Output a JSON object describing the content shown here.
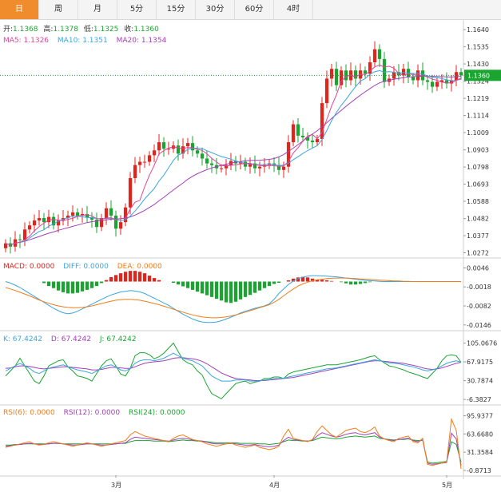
{
  "tabs": [
    "日",
    "周",
    "月",
    "5分",
    "15分",
    "30分",
    "60分",
    "4时"
  ],
  "active_tab": 0,
  "colors": {
    "up": "#e4231b",
    "down": "#1aa531",
    "ma5": "#e0449a",
    "ma10": "#3aa6e0",
    "ma20": "#a340b6",
    "dif": "#3aa6e0",
    "dea": "#f07d1a",
    "k": "#3aa6e0",
    "d": "#a340b6",
    "j": "#1aa531",
    "rsi6": "#f07d1a",
    "rsi12": "#a340b6",
    "rsi24": "#1aa531"
  },
  "legend": {
    "ohlc": {
      "open_label": "开:",
      "open": "1.1368",
      "high_label": "高:",
      "high": "1.1378",
      "low_label": "低:",
      "low": "1.1325",
      "close_label": "收:",
      "close": "1.1360"
    },
    "ma": {
      "ma5": "MA5: 1.1326",
      "ma10": "MA10: 1.1351",
      "ma20": "MA20: 1.1354"
    },
    "macd": {
      "macd": "MACD: 0.0000",
      "dif": "DIFF: 0.0000",
      "dea": "DEA: 0.0000"
    },
    "kdj": {
      "k": "K: 67.4242",
      "d": "D: 67.4242",
      "j": "J: 67.4242"
    },
    "rsi": {
      "r6": "RSI(6): 0.0000",
      "r12": "RSI(12): 0.0000",
      "r24": "RSI(24): 0.0000"
    }
  },
  "chart_data": {
    "type": "candlestick",
    "last_price": "1.1360",
    "price_axis": [
      "1.1640",
      "1.1535",
      "1.1430",
      "1.1324",
      "1.1219",
      "1.1114",
      "1.1009",
      "1.0903",
      "1.0798",
      "1.0693",
      "1.0588",
      "1.0482",
      "1.0377",
      "1.0272"
    ],
    "price_range": [
      1.025,
      1.168
    ],
    "macd_axis": [
      "0.0046",
      "-0.0018",
      "-0.0082",
      "-0.0146"
    ],
    "macd_range": [
      -0.016,
      0.0066
    ],
    "kdj_axis": [
      "105.0676",
      "67.9175",
      "30.7874",
      "-6.3827"
    ],
    "kdj_range": [
      -14,
      120
    ],
    "rsi_axis": [
      "95.9377",
      "63.6680",
      "31.3584",
      "-0.8713"
    ],
    "rsi_range": [
      -8,
      108
    ],
    "x_labels": [
      {
        "label": "3月",
        "index": 23
      },
      {
        "label": "4月",
        "index": 56
      },
      {
        "label": "5月",
        "index": 92
      }
    ],
    "closes": [
      1.033,
      1.031,
      1.0355,
      1.035,
      1.0415,
      1.044,
      1.047,
      1.0485,
      1.046,
      1.0492,
      1.044,
      1.047,
      1.0485,
      1.05,
      1.052,
      1.05,
      1.051,
      1.049,
      1.0475,
      1.043,
      1.0485,
      1.0545,
      1.05,
      1.042,
      1.046,
      1.055,
      1.073,
      1.081,
      1.083,
      1.083,
      1.087,
      1.09,
      1.095,
      1.091,
      1.091,
      1.093,
      1.088,
      1.0925,
      1.0945,
      1.09,
      1.088,
      1.085,
      1.082,
      1.081,
      1.079,
      1.079,
      1.081,
      1.0835,
      1.082,
      1.083,
      1.08,
      1.082,
      1.079,
      1.08,
      1.081,
      1.082,
      1.081,
      1.078,
      1.08,
      1.095,
      1.106,
      1.099,
      1.098,
      1.096,
      1.095,
      1.097,
      1.119,
      1.134,
      1.14,
      1.13,
      1.139,
      1.133,
      1.139,
      1.134,
      1.139,
      1.137,
      1.144,
      1.152,
      1.146,
      1.132,
      1.134,
      1.138,
      1.136,
      1.14,
      1.135,
      1.133,
      1.139,
      1.133,
      1.132,
      1.129,
      1.132,
      1.133,
      1.131,
      1.133,
      1.138,
      1.136
    ],
    "ma5": [
      1.033,
      1.032,
      1.0332,
      1.0336,
      1.0352,
      1.0374,
      1.0406,
      1.0433,
      1.0454,
      1.0473,
      1.0477,
      1.0473,
      1.0469,
      1.0477,
      1.0483,
      1.0495,
      1.0503,
      1.0504,
      1.0499,
      1.0481,
      1.0478,
      1.0485,
      1.0487,
      1.0476,
      1.0482,
      1.0483,
      1.0541,
      1.0582,
      1.0594,
      1.0676,
      1.0748,
      1.0808,
      1.0878,
      1.0898,
      1.0914,
      1.0922,
      1.0916,
      1.0911,
      1.0918,
      1.0916,
      1.0906,
      1.09,
      1.0879,
      1.0852,
      1.083,
      1.0808,
      1.0804,
      1.0809,
      1.0811,
      1.0817,
      1.0819,
      1.0821,
      1.0812,
      1.0808,
      1.0804,
      1.0808,
      1.0806,
      1.0802,
      1.0804,
      1.0832,
      1.0884,
      1.0916,
      1.0956,
      1.0988,
      1.0998,
      1.097,
      1.101,
      1.109,
      1.1172,
      1.124,
      1.1324,
      1.1352,
      1.1362,
      1.135,
      1.1368,
      1.1364,
      1.1386,
      1.1412,
      1.1424,
      1.141,
      1.1416,
      1.1404,
      1.1372,
      1.136,
      1.137,
      1.1364,
      1.1362,
      1.1358,
      1.135,
      1.1336,
      1.133,
      1.1318,
      1.1314,
      1.1314,
      1.133,
      1.1342
    ],
    "ma10": [
      1.033,
      1.032,
      1.0332,
      1.0336,
      1.0342,
      1.0363,
      1.0383,
      1.0403,
      1.0413,
      1.0435,
      1.0449,
      1.0465,
      1.0478,
      1.0487,
      1.0497,
      1.0497,
      1.0493,
      1.0488,
      1.0487,
      1.0482,
      1.048,
      1.0484,
      1.0483,
      1.0475,
      1.0469,
      1.0474,
      1.0497,
      1.0528,
      1.0563,
      1.0602,
      1.0634,
      1.0667,
      1.0712,
      1.0748,
      1.0793,
      1.0839,
      1.0871,
      1.0883,
      1.0906,
      1.0913,
      1.0913,
      1.0911,
      1.0898,
      1.0886,
      1.0874,
      1.0862,
      1.0855,
      1.0846,
      1.0835,
      1.0828,
      1.082,
      1.0817,
      1.0813,
      1.0812,
      1.0813,
      1.0815,
      1.0813,
      1.0807,
      1.081,
      1.082,
      1.0843,
      1.0861,
      1.0881,
      1.0899,
      1.0914,
      1.0929,
      1.0966,
      1.1022,
      1.1082,
      1.1132,
      1.1176,
      1.1212,
      1.1253,
      1.1291,
      1.1325,
      1.134,
      1.1367,
      1.1382,
      1.1389,
      1.138,
      1.1383,
      1.1379,
      1.1372,
      1.1378,
      1.1374,
      1.137,
      1.1374,
      1.1367,
      1.1357,
      1.1348,
      1.1346,
      1.134,
      1.1333,
      1.1327,
      1.133,
      1.1336
    ],
    "ma20": [
      1.033,
      1.032,
      1.0332,
      1.0336,
      1.0342,
      1.0352,
      1.0362,
      1.0372,
      1.0382,
      1.0392,
      1.04,
      1.041,
      1.0418,
      1.0426,
      1.0434,
      1.0442,
      1.045,
      1.0457,
      1.0463,
      1.0467,
      1.047,
      1.0474,
      1.0478,
      1.0478,
      1.0481,
      1.0485,
      1.0492,
      1.0503,
      1.0517,
      1.0532,
      1.055,
      1.0568,
      1.0591,
      1.0612,
      1.0635,
      1.0657,
      1.0679,
      1.07,
      1.0723,
      1.0741,
      1.0757,
      1.077,
      1.0782,
      1.0792,
      1.0801,
      1.0808,
      1.0815,
      1.0822,
      1.0828,
      1.0832,
      1.0836,
      1.0838,
      1.0839,
      1.084,
      1.0842,
      1.0845,
      1.085,
      1.086,
      1.0875,
      1.0893,
      1.0914,
      1.0935,
      1.0957,
      1.0979,
      1.1,
      1.1021,
      1.1045,
      1.107,
      1.1096,
      1.112,
      1.1145,
      1.1169,
      1.1193,
      1.1216,
      1.1239,
      1.1259,
      1.1279,
      1.1298,
      1.1314,
      1.1323,
      1.133,
      1.1336,
      1.1341,
      1.1346,
      1.135,
      1.1352,
      1.1354,
      1.1355,
      1.1355,
      1.1354,
      1.1353,
      1.1352,
      1.1351,
      1.135,
      1.1352,
      1.1354
    ],
    "macd_hist": [
      0,
      0,
      0,
      0,
      0,
      0,
      0,
      0,
      -0.0005,
      -0.0015,
      -0.0022,
      -0.003,
      -0.0036,
      -0.004,
      -0.004,
      -0.0038,
      -0.0033,
      -0.0028,
      -0.0022,
      -0.0015,
      -0.0005,
      0.0005,
      0.0015,
      0.0022,
      0.0028,
      0.0033,
      0.0036,
      0.0036,
      0.0033,
      0.0028,
      0.002,
      0.0012,
      0.0005,
      0,
      0,
      -0.0004,
      -0.001,
      -0.0016,
      -0.0022,
      -0.0028,
      -0.0034,
      -0.004,
      -0.0046,
      -0.0052,
      -0.0058,
      -0.0064,
      -0.007,
      -0.0072,
      -0.0068,
      -0.006,
      -0.0052,
      -0.0045,
      -0.0038,
      -0.003,
      -0.0022,
      -0.0015,
      -0.0008,
      -0.0004,
      0,
      0.0004,
      0.001,
      0.0014,
      0.0016,
      0.0014,
      0.001,
      0.0006,
      0.0006,
      0.0004,
      0.0002,
      0,
      -0.0002,
      -0.0006,
      -0.001,
      -0.001,
      -0.0008,
      -0.0005,
      -0.0002,
      0,
      0,
      0,
      0,
      0,
      0,
      0,
      0,
      0,
      0,
      0,
      0,
      0,
      0,
      0,
      0,
      0,
      0,
      0
    ],
    "macd_dif": [
      0,
      -0.0005,
      -0.0012,
      -0.002,
      -0.003,
      -0.004,
      -0.005,
      -0.006,
      -0.007,
      -0.008,
      -0.009,
      -0.0098,
      -0.0105,
      -0.0108,
      -0.0106,
      -0.01,
      -0.0092,
      -0.0084,
      -0.0076,
      -0.0068,
      -0.006,
      -0.0052,
      -0.0045,
      -0.004,
      -0.0035,
      -0.0033,
      -0.003,
      -0.0032,
      -0.0035,
      -0.004,
      -0.0048,
      -0.0056,
      -0.0064,
      -0.0072,
      -0.008,
      -0.009,
      -0.01,
      -0.011,
      -0.0118,
      -0.0126,
      -0.0132,
      -0.0136,
      -0.0138,
      -0.0138,
      -0.0136,
      -0.0132,
      -0.0126,
      -0.012,
      -0.0113,
      -0.0106,
      -0.01,
      -0.0095,
      -0.009,
      -0.0086,
      -0.0082,
      -0.0075,
      -0.006,
      -0.004,
      -0.0025,
      -0.001,
      0.0002,
      0.001,
      0.0015,
      0.0018,
      0.002,
      0.002,
      0.0019,
      0.0018,
      0.0017,
      0.0016,
      0.0014,
      0.0012,
      0.001,
      0.0008,
      0.0006,
      0.0004,
      0.0003,
      0.0002,
      0.0001,
      0,
      0,
      0,
      0,
      0,
      0,
      0,
      0,
      0,
      0,
      0,
      0,
      0,
      0,
      0,
      0,
      0
    ],
    "macd_dea": [
      -0.002,
      -0.0025,
      -0.003,
      -0.0036,
      -0.0042,
      -0.0048,
      -0.0055,
      -0.0062,
      -0.0068,
      -0.0073,
      -0.0078,
      -0.0082,
      -0.0085,
      -0.0087,
      -0.0088,
      -0.0088,
      -0.0087,
      -0.0085,
      -0.0082,
      -0.0078,
      -0.0074,
      -0.007,
      -0.0066,
      -0.0063,
      -0.0061,
      -0.006,
      -0.006,
      -0.0061,
      -0.0063,
      -0.0066,
      -0.007,
      -0.0074,
      -0.0078,
      -0.0083,
      -0.0088,
      -0.0093,
      -0.0098,
      -0.0103,
      -0.0108,
      -0.0112,
      -0.0116,
      -0.0119,
      -0.0121,
      -0.0122,
      -0.0122,
      -0.0121,
      -0.0119,
      -0.0116,
      -0.0112,
      -0.0108,
      -0.0103,
      -0.0098,
      -0.0093,
      -0.0088,
      -0.0083,
      -0.0078,
      -0.007,
      -0.006,
      -0.0048,
      -0.0036,
      -0.0025,
      -0.0015,
      -0.0008,
      -0.0002,
      0.0003,
      0.0006,
      0.0008,
      0.001,
      0.0011,
      0.0012,
      0.0012,
      0.0012,
      0.0011,
      0.001,
      0.0009,
      0.0008,
      0.0007,
      0.0006,
      0.0005,
      0.0004,
      0.0003,
      0.0002,
      0.0002,
      0.0001,
      0.0001,
      0,
      0,
      0,
      0,
      0,
      0,
      0,
      0,
      0,
      0,
      0
    ],
    "kdj_k": [
      50,
      55,
      60,
      65,
      60,
      55,
      48,
      45,
      50,
      55,
      58,
      60,
      62,
      58,
      55,
      52,
      50,
      48,
      45,
      50,
      55,
      60,
      62,
      58,
      52,
      50,
      55,
      65,
      70,
      72,
      72,
      70,
      72,
      75,
      80,
      85,
      80,
      75,
      72,
      70,
      65,
      60,
      50,
      40,
      35,
      30,
      30,
      30,
      32,
      32,
      32,
      30,
      30,
      30,
      32,
      33,
      35,
      35,
      35,
      38,
      40,
      42,
      44,
      46,
      48,
      50,
      52,
      54,
      55,
      56,
      58,
      60,
      62,
      64,
      66,
      68,
      70,
      72,
      70,
      68,
      66,
      65,
      64,
      62,
      60,
      58,
      55,
      52,
      50,
      52,
      55,
      60,
      65,
      68,
      70,
      67
    ],
    "kdj_d": [
      55,
      56,
      58,
      60,
      60,
      59,
      57,
      55,
      54,
      55,
      56,
      57,
      58,
      58,
      57,
      56,
      55,
      54,
      52,
      52,
      53,
      55,
      57,
      57,
      56,
      55,
      55,
      58,
      62,
      65,
      67,
      68,
      69,
      70,
      72,
      75,
      76,
      76,
      75,
      74,
      72,
      69,
      64,
      58,
      52,
      46,
      42,
      38,
      35,
      34,
      33,
      32,
      31,
      31,
      31,
      32,
      33,
      34,
      35,
      36,
      37,
      39,
      41,
      43,
      45,
      47,
      49,
      51,
      53,
      55,
      57,
      59,
      61,
      63,
      65,
      67,
      69,
      70,
      70,
      69,
      68,
      67,
      66,
      65,
      63,
      61,
      59,
      56,
      54,
      53,
      54,
      56,
      59,
      62,
      65,
      67
    ],
    "kdj_j": [
      40,
      50,
      60,
      75,
      60,
      45,
      30,
      25,
      40,
      60,
      65,
      70,
      72,
      58,
      50,
      40,
      38,
      35,
      30,
      45,
      60,
      70,
      74,
      60,
      44,
      40,
      55,
      80,
      86,
      86,
      82,
      74,
      78,
      85,
      95,
      105,
      88,
      72,
      66,
      62,
      50,
      42,
      22,
      5,
      0,
      -5,
      5,
      15,
      25,
      28,
      30,
      25,
      28,
      30,
      35,
      35,
      38,
      38,
      35,
      44,
      48,
      50,
      52,
      54,
      56,
      58,
      60,
      62,
      62,
      62,
      64,
      66,
      68,
      70,
      72,
      75,
      78,
      80,
      72,
      66,
      60,
      58,
      55,
      52,
      48,
      45,
      42,
      38,
      35,
      45,
      55,
      70,
      80,
      82,
      80,
      67
    ],
    "rsi6": [
      40,
      42,
      44,
      46,
      48,
      50,
      46,
      44,
      45,
      48,
      50,
      48,
      46,
      44,
      42,
      44,
      46,
      48,
      46,
      44,
      42,
      44,
      46,
      48,
      50,
      52,
      62,
      68,
      64,
      60,
      58,
      56,
      54,
      52,
      50,
      56,
      60,
      62,
      58,
      54,
      52,
      50,
      46,
      44,
      42,
      44,
      46,
      48,
      44,
      42,
      40,
      42,
      44,
      40,
      38,
      36,
      38,
      42,
      60,
      72,
      56,
      54,
      52,
      50,
      54,
      68,
      78,
      70,
      62,
      58,
      64,
      70,
      72,
      74,
      68,
      66,
      70,
      76,
      60,
      55,
      52,
      50,
      56,
      58,
      60,
      50,
      48,
      56,
      10,
      8,
      10,
      12,
      14,
      90,
      70,
      2
    ],
    "rsi12": [
      42,
      43,
      44,
      45,
      46,
      47,
      46,
      45,
      45,
      46,
      47,
      47,
      46,
      45,
      44,
      44,
      45,
      46,
      46,
      45,
      44,
      44,
      45,
      46,
      47,
      48,
      54,
      58,
      57,
      56,
      55,
      54,
      53,
      52,
      51,
      53,
      55,
      56,
      55,
      53,
      52,
      51,
      49,
      47,
      46,
      46,
      46,
      47,
      46,
      45,
      44,
      44,
      45,
      43,
      42,
      41,
      42,
      44,
      52,
      58,
      54,
      53,
      52,
      51,
      53,
      60,
      66,
      63,
      60,
      58,
      60,
      63,
      65,
      66,
      63,
      62,
      64,
      66,
      58,
      55,
      53,
      52,
      54,
      55,
      56,
      52,
      50,
      53,
      12,
      10,
      11,
      12,
      13,
      65,
      55,
      8
    ],
    "rsi24": [
      44,
      44,
      45,
      45,
      46,
      46,
      46,
      46,
      46,
      46,
      47,
      47,
      46,
      46,
      46,
      46,
      46,
      46,
      46,
      46,
      46,
      46,
      46,
      46,
      47,
      47,
      50,
      52,
      52,
      52,
      52,
      51,
      51,
      51,
      50,
      51,
      52,
      53,
      52,
      52,
      51,
      51,
      50,
      49,
      48,
      48,
      48,
      48,
      48,
      47,
      47,
      47,
      47,
      46,
      46,
      45,
      46,
      47,
      50,
      53,
      52,
      52,
      51,
      51,
      52,
      55,
      58,
      57,
      56,
      55,
      56,
      58,
      59,
      60,
      59,
      58,
      59,
      60,
      56,
      55,
      54,
      53,
      54,
      54,
      55,
      53,
      52,
      53,
      14,
      12,
      13,
      14,
      15,
      50,
      45,
      14
    ]
  }
}
